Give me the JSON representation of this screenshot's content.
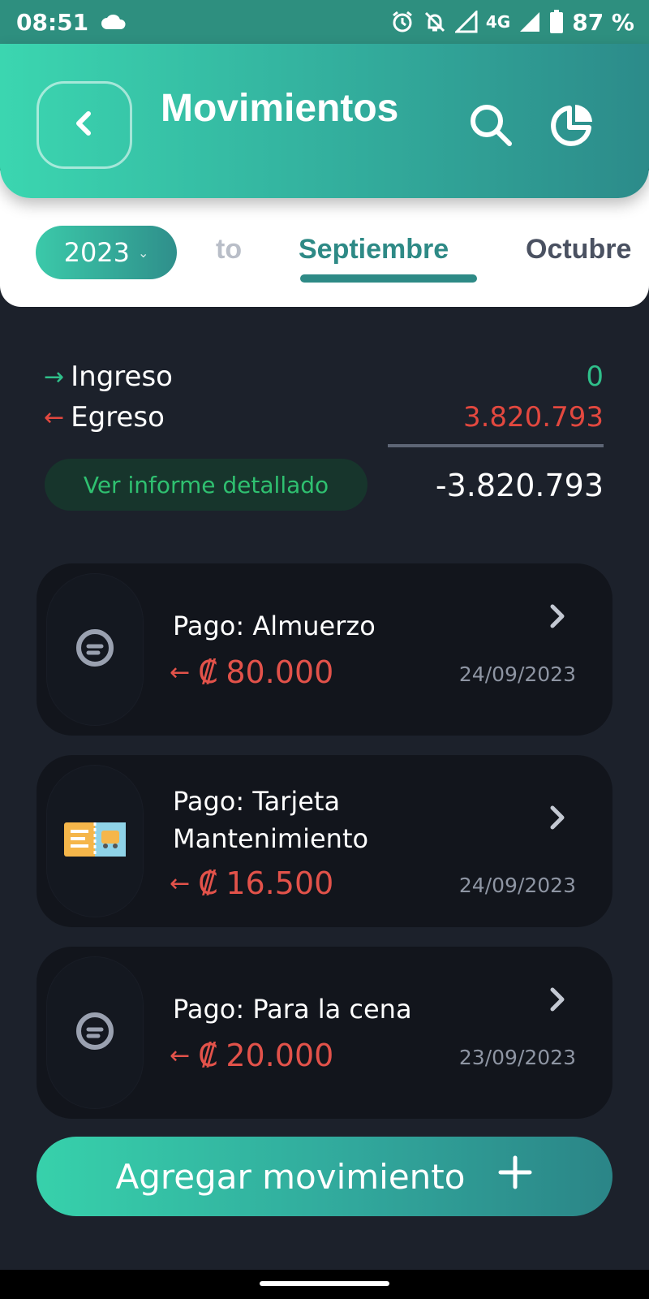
{
  "status_bar": {
    "time": "08:51",
    "network": "4G",
    "battery": "87 %",
    "icons": [
      "cloud-icon",
      "alarm-icon",
      "notifications-off-icon",
      "signal-icon",
      "battery-icon"
    ]
  },
  "header": {
    "title": "Movimientos",
    "icons": [
      "back-arrow-icon",
      "search-icon",
      "pie-chart-icon"
    ]
  },
  "period": {
    "year": "2023",
    "tabs": [
      {
        "label": "to",
        "active": false
      },
      {
        "label": "Septiembre",
        "active": true
      },
      {
        "label": "Octubre",
        "active": false
      }
    ]
  },
  "summary": {
    "income_label": "Ingreso",
    "income_value": "0",
    "expense_label": "Egreso",
    "expense_value": "3.820.793",
    "net_value": "-3.820.793",
    "report_button": "Ver informe detallado"
  },
  "transactions": [
    {
      "title": "Pago: Almuerzo",
      "currency": "₡",
      "amount": "80.000",
      "date": "24/09/2023",
      "icon": "note-icon"
    },
    {
      "title": "Pago: Tarjeta Mantenimiento",
      "currency": "₡",
      "amount": "16.500",
      "date": "24/09/2023",
      "icon": "bus-ticket-icon"
    },
    {
      "title": "Pago: Para la cena",
      "currency": "₡",
      "amount": "20.000",
      "date": "23/09/2023",
      "icon": "note-icon"
    }
  ],
  "add_button": "Agregar movimiento",
  "colors": {
    "accent": "#3bd6b0",
    "accent_dark": "#2e8a86",
    "income": "#2fbf8a",
    "expense": "#e2483f",
    "background": "#1c212b"
  }
}
